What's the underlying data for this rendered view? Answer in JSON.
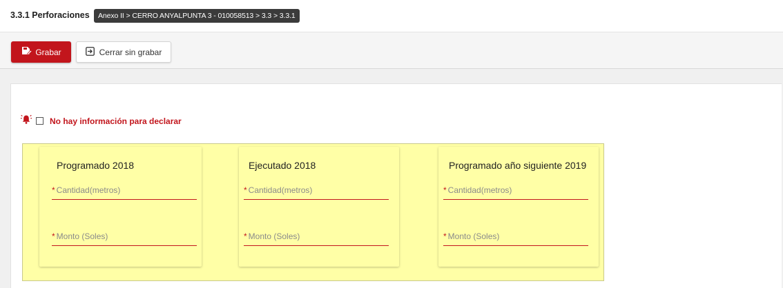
{
  "header": {
    "title": "3.3.1 Perforaciones",
    "breadcrumb": "Anexo II > CERRO ANYALPUNTA 3 - 010058513 > 3.3 > 3.3.1"
  },
  "toolbar": {
    "save_label": "Grabar",
    "cancel_label": "Cerrar sin grabar"
  },
  "form": {
    "no_info_label": "No hay información para declarar",
    "no_info_checked": false,
    "required_mark": "*",
    "cards": [
      {
        "title": "Programado 2018",
        "quantity_placeholder": "Cantidad(metros)",
        "amount_placeholder": "Monto (Soles)"
      },
      {
        "title": "Ejecutado 2018",
        "quantity_placeholder": "Cantidad(metros)",
        "amount_placeholder": "Monto (Soles)"
      },
      {
        "title": "Programado año siguiente 2019",
        "quantity_placeholder": "Cantidad(metros)",
        "amount_placeholder": "Monto (Soles)"
      }
    ]
  },
  "icons": {
    "save": "save-edit-icon",
    "cancel": "exit-icon",
    "alert": "alarm-bell-icon"
  },
  "colors": {
    "accent": "#c2151c",
    "panel_highlight": "#ffffa6",
    "breadcrumb_bg": "#3b3b3b"
  }
}
